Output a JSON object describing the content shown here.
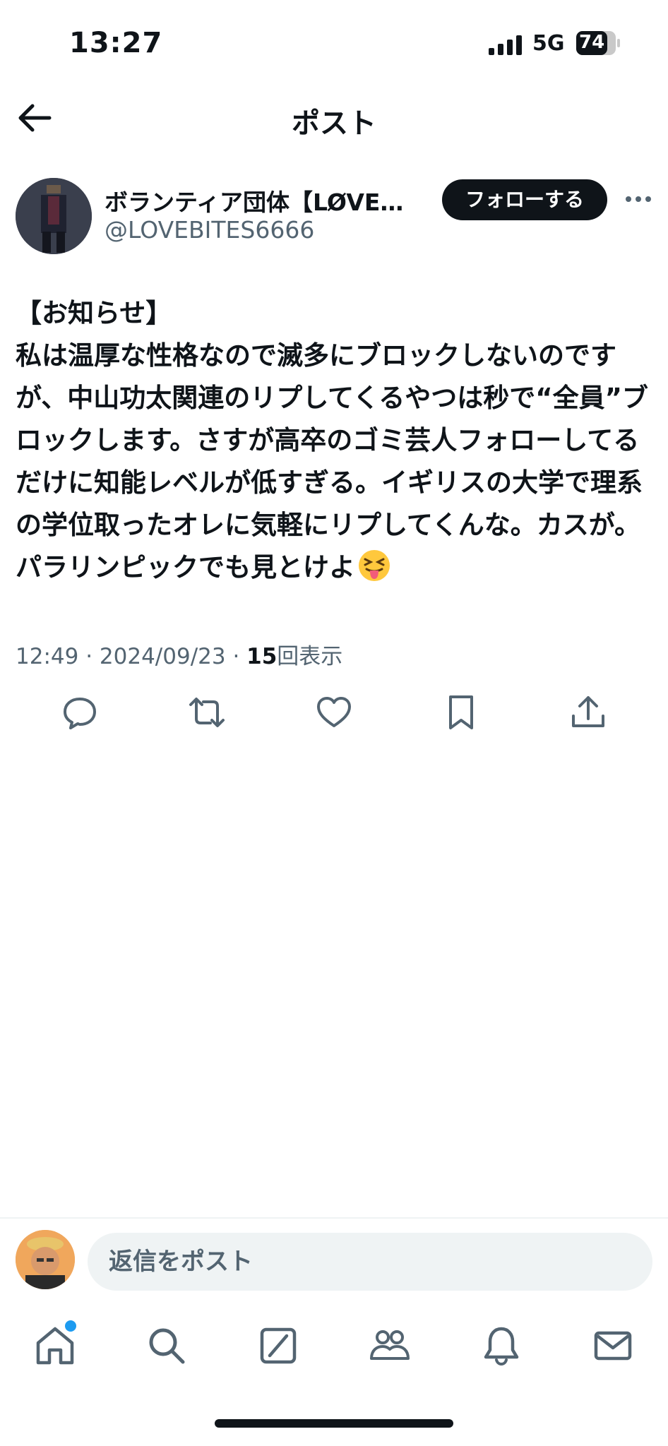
{
  "status_bar": {
    "time": "13:27",
    "network": "5G",
    "battery": "74"
  },
  "header": {
    "title": "ポスト",
    "back_icon": "arrow-left-icon"
  },
  "author": {
    "name": "ボランティア団体【LØVE…",
    "handle": "@LOVEBITES6666",
    "follow_label": "フォローする",
    "more_icon": "more-horizontal-icon"
  },
  "post": {
    "text": "【お知らせ】\n私は温厚な性格なので滅多にブロックしないのですが、中山功太関連のリプしてくるやつは秒で“全員”ブロックします。さすが高卒のゴミ芸人フォローしてるだけに知能レベルが低すぎる。イギリスの大学で理系の学位取ったオレに気軽にリプしてくんな。カスが。パラリンピックでも見とけよ",
    "emoji": "squinting-face-with-tongue-emoji",
    "time": "12:49",
    "date": "2024/09/23",
    "views_count": "15",
    "views_label": "回表示",
    "separator": " · "
  },
  "actions": [
    "reply-icon",
    "repost-icon",
    "like-icon",
    "bookmark-icon",
    "share-icon"
  ],
  "reply_bar": {
    "placeholder": "返信をポスト"
  },
  "tab_bar": [
    "home-icon",
    "search-icon",
    "grok-icon",
    "communities-icon",
    "notifications-icon",
    "messages-icon"
  ],
  "colors": {
    "accent": "#1d9bf0",
    "text": "#0f1419",
    "secondary": "#536471",
    "follow_bg": "#0f1419"
  }
}
